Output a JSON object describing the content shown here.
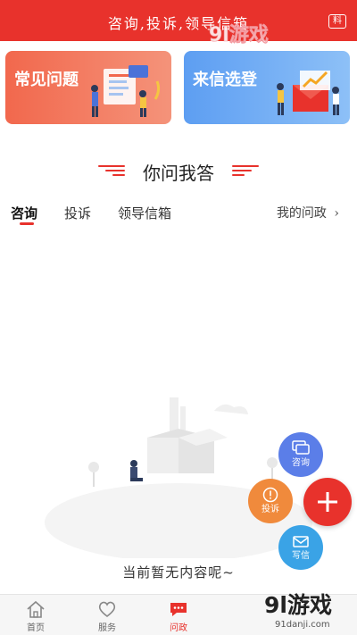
{
  "header": {
    "title": "咨询,投诉,领导信箱",
    "action_label": "料"
  },
  "watermark": {
    "brand": "9l游戏",
    "domain": "91danji.com"
  },
  "banners": [
    {
      "label": "常见问题"
    },
    {
      "label": "来信选登"
    }
  ],
  "section": {
    "title": "你问我答"
  },
  "tabs": [
    {
      "label": "咨询",
      "active": true
    },
    {
      "label": "投诉",
      "active": false
    },
    {
      "label": "领导信箱",
      "active": false
    }
  ],
  "my_questions": {
    "label": "我的问政",
    "icon": "chevron-right-icon"
  },
  "empty_state": {
    "text": "当前暂无内容呢~"
  },
  "fabs": {
    "consult": {
      "label": "咨询",
      "icon": "chat-icon"
    },
    "complain": {
      "label": "投诉",
      "icon": "alert-icon"
    },
    "write": {
      "label": "写信",
      "icon": "mail-icon"
    },
    "plus": {
      "icon": "plus-icon"
    }
  },
  "bottom_nav": [
    {
      "label": "首页",
      "icon": "home-icon",
      "active": false
    },
    {
      "label": "服务",
      "icon": "heart-icon",
      "active": false
    },
    {
      "label": "问政",
      "icon": "chat-icon",
      "active": true
    }
  ],
  "colors": {
    "primary": "#e8322c",
    "orange": "#f08a3c",
    "blue": "#5b7ee8"
  }
}
